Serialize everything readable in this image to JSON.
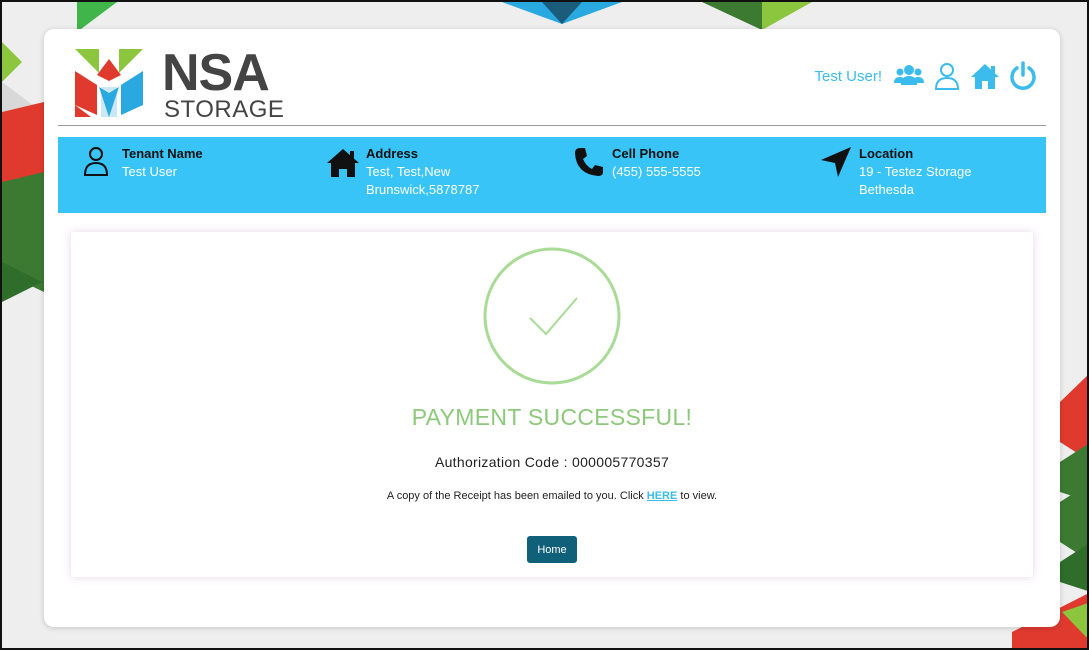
{
  "brand": {
    "name": "NSA",
    "subtitle": "STORAGE"
  },
  "header": {
    "greeting": "Test User!",
    "icons": [
      "users-icon",
      "user-icon",
      "home-icon",
      "power-icon"
    ]
  },
  "tenant": {
    "name_label": "Tenant Name",
    "name_value": "Test User",
    "address_label": "Address",
    "address_line1": "Test, Test,New",
    "address_line2": "Brunswick,5878787",
    "phone_label": "Cell Phone",
    "phone_value": "(455) 555-5555",
    "location_label": "Location",
    "location_line1": "19 - Testez Storage",
    "location_line2": "Bethesda"
  },
  "result": {
    "title": "PAYMENT SUCCESSFUL!",
    "auth_text": "Authorization Code : 000005770357",
    "receipt_before": "A copy of the Receipt has been emailed to you. Click ",
    "receipt_link": "HERE",
    "receipt_after": " to view.",
    "home_button": "Home"
  },
  "colors": {
    "accent": "#3bbcec",
    "info_bar": "#38c4f6",
    "success": "#8cc97a",
    "button": "#10607a",
    "logo_green": "#8cc63f",
    "logo_red": "#e03a2f",
    "logo_blue": "#2aa8e0"
  }
}
